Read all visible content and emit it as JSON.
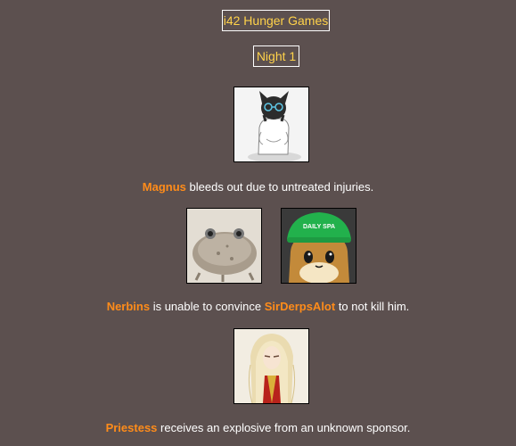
{
  "header": {
    "title": "i42 Hunger Games",
    "phase": "Night 1"
  },
  "events": [
    {
      "actors": [
        "Magnus"
      ],
      "parts": [
        {
          "type": "name",
          "text": "Magnus"
        },
        {
          "type": "text",
          "text": " bleeds out due to untreated injuries."
        }
      ]
    },
    {
      "actors": [
        "Nerbins",
        "SirDerpsAlot"
      ],
      "parts": [
        {
          "type": "name",
          "text": "Nerbins"
        },
        {
          "type": "text",
          "text": " is unable to convince "
        },
        {
          "type": "name",
          "text": "SirDerpsAlot"
        },
        {
          "type": "text",
          "text": " to not kill him."
        }
      ]
    },
    {
      "actors": [
        "Priestess"
      ],
      "parts": [
        {
          "type": "name",
          "text": "Priestess"
        },
        {
          "type": "text",
          "text": " receives an explosive from an unknown sponsor."
        }
      ]
    }
  ],
  "avatars": {
    "hat_text": "DAILY SPA"
  },
  "colors": {
    "background": "#5c504f",
    "title_text": "#ffd24a",
    "name_text": "#ff8c1a",
    "body_text": "#ffffff"
  }
}
